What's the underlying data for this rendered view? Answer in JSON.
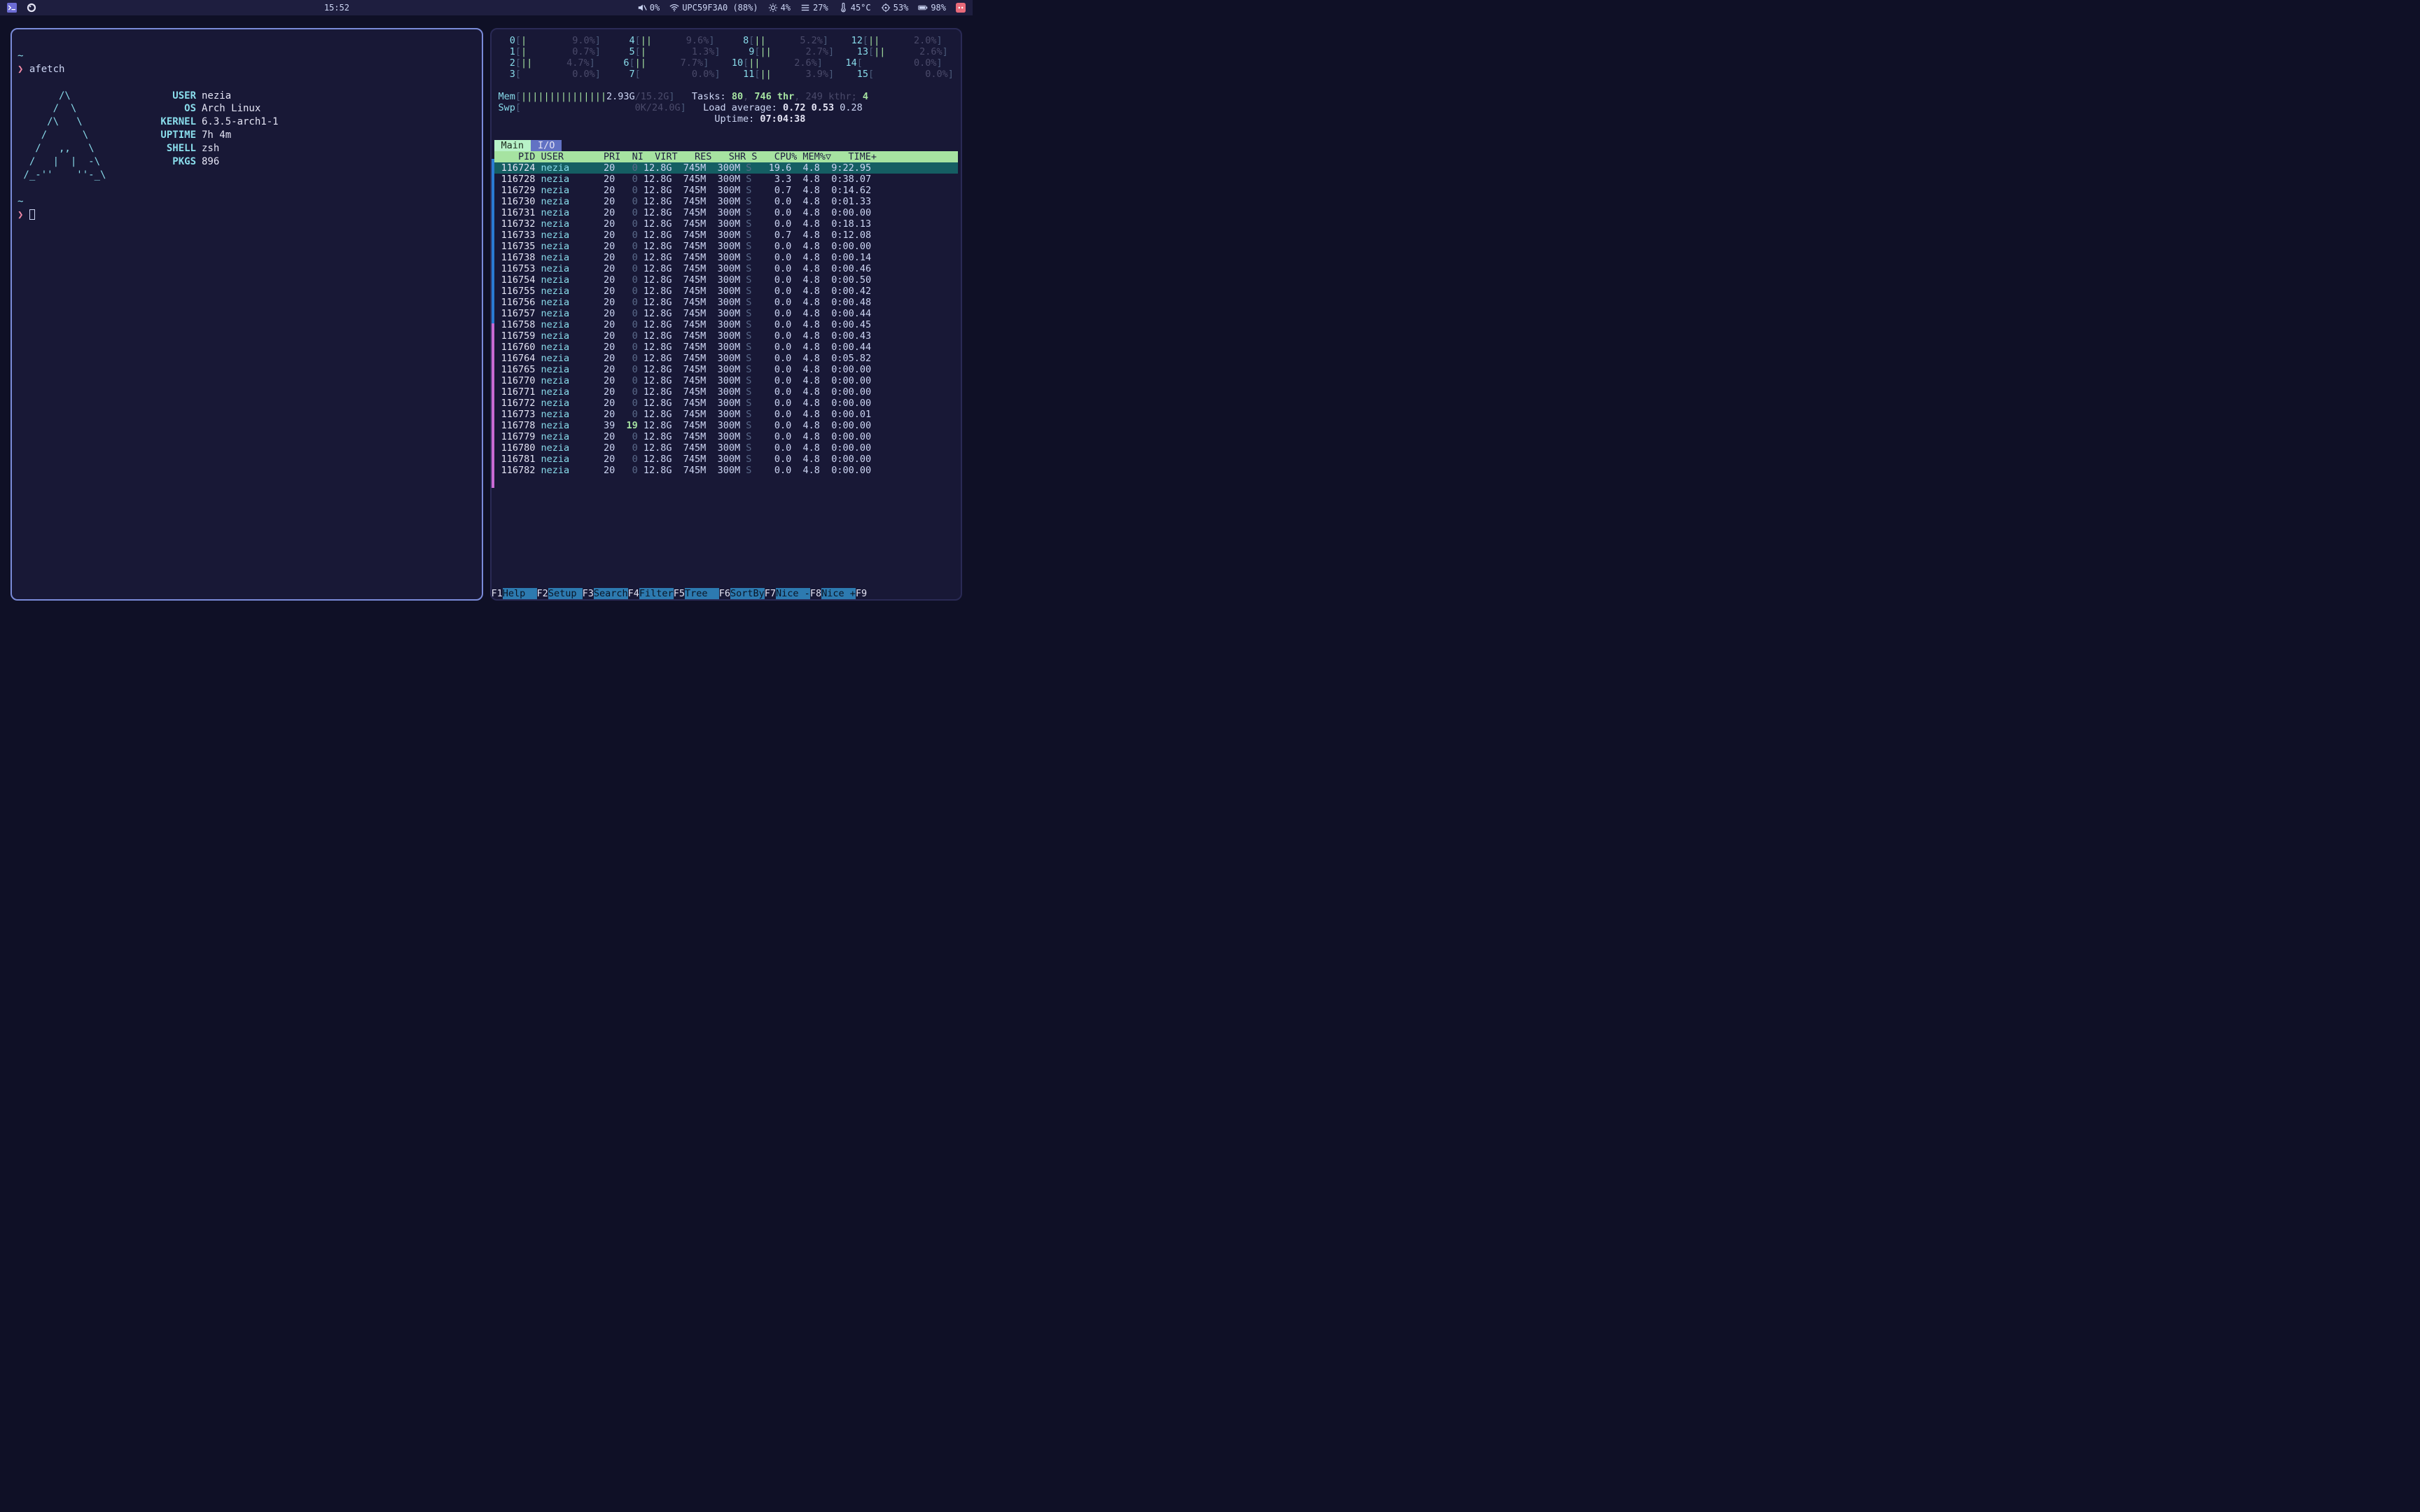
{
  "topbar": {
    "clock": "15:52",
    "volume_pct": "0%",
    "wifi_ssid": "UPC59F3A0 (88%)",
    "brightness_pct": "4%",
    "storage_pct": "27%",
    "temp": "45°C",
    "cpu_pct": "53%",
    "battery_pct": "98%"
  },
  "left_pane": {
    "prompt_symbol": "❯",
    "command": "afetch",
    "art": [
      "       /\\        ",
      "      /  \\       ",
      "     /\\   \\      ",
      "    /      \\     ",
      "   /   ,,   \\    ",
      "  /   |  |  -\\   ",
      " /_-''    ''-_\\  "
    ],
    "info": {
      "USER": "nezia",
      "OS": "Arch Linux",
      "KERNEL": "6.3.5-arch1-1",
      "UPTIME": "7h 4m",
      "SHELL": "zsh",
      "PKGS": "896"
    }
  },
  "htop": {
    "cpus": [
      {
        "n": "0",
        "bar": "|       ",
        "pct": "9.0%"
      },
      {
        "n": "1",
        "bar": "|       ",
        "pct": "0.7%"
      },
      {
        "n": "2",
        "bar": "||     ",
        "pct": "4.7%"
      },
      {
        "n": "3",
        "bar": "        ",
        "pct": "0.0%"
      },
      {
        "n": "4",
        "bar": "||     ",
        "pct": "9.6%"
      },
      {
        "n": "5",
        "bar": "|       ",
        "pct": "1.3%"
      },
      {
        "n": "6",
        "bar": "||     ",
        "pct": "7.7%"
      },
      {
        "n": "7",
        "bar": "        ",
        "pct": "0.0%"
      },
      {
        "n": "8",
        "bar": "||     ",
        "pct": "5.2%"
      },
      {
        "n": "9",
        "bar": "||     ",
        "pct": "2.7%"
      },
      {
        "n": "10",
        "bar": "||     ",
        "pct": "2.6%"
      },
      {
        "n": "11",
        "bar": "||     ",
        "pct": "3.9%"
      },
      {
        "n": "12",
        "bar": "||     ",
        "pct": "2.0%"
      },
      {
        "n": "13",
        "bar": "||     ",
        "pct": "2.6%"
      },
      {
        "n": "14",
        "bar": "        ",
        "pct": "0.0%"
      },
      {
        "n": "15",
        "bar": "        ",
        "pct": "0.0%"
      }
    ],
    "mem_label": "Mem",
    "mem_bar": "|||||||||||||||",
    "mem_used": "2.93G",
    "mem_total": "15.2G",
    "swp_label": "Swp",
    "swp_used": "0K",
    "swp_total": "24.0G",
    "tasks_label": "Tasks:",
    "tasks_procs": "80",
    "tasks_thr": "746",
    "tasks_thr_suffix": "thr",
    "tasks_kthr": "249",
    "tasks_kthr_suffix": "kthr",
    "tasks_running": "4",
    "load_label": "Load average:",
    "load": [
      "0.72",
      "0.53",
      "0.28"
    ],
    "uptime_label": "Uptime:",
    "uptime": "07:04:38",
    "tab_main": "Main",
    "tab_io": "I/O",
    "header": "    PID USER       PRI  NI  VIRT   RES   SHR S   CPU% MEM%▽   TIME+",
    "procs": [
      {
        "pid": "116724",
        "user": "nezia",
        "pri": "20",
        "ni": "0",
        "virt": "12.8G",
        "res": "745M",
        "shr": "300M",
        "s": "S",
        "cpu": "19.6",
        "mem": "4.8",
        "time": "9:22.95",
        "sel": true
      },
      {
        "pid": "116728",
        "user": "nezia",
        "pri": "20",
        "ni": "0",
        "virt": "12.8G",
        "res": "745M",
        "shr": "300M",
        "s": "S",
        "cpu": "3.3",
        "mem": "4.8",
        "time": "0:38.07"
      },
      {
        "pid": "116729",
        "user": "nezia",
        "pri": "20",
        "ni": "0",
        "virt": "12.8G",
        "res": "745M",
        "shr": "300M",
        "s": "S",
        "cpu": "0.7",
        "mem": "4.8",
        "time": "0:14.62"
      },
      {
        "pid": "116730",
        "user": "nezia",
        "pri": "20",
        "ni": "0",
        "virt": "12.8G",
        "res": "745M",
        "shr": "300M",
        "s": "S",
        "cpu": "0.0",
        "mem": "4.8",
        "time": "0:01.33"
      },
      {
        "pid": "116731",
        "user": "nezia",
        "pri": "20",
        "ni": "0",
        "virt": "12.8G",
        "res": "745M",
        "shr": "300M",
        "s": "S",
        "cpu": "0.0",
        "mem": "4.8",
        "time": "0:00.00"
      },
      {
        "pid": "116732",
        "user": "nezia",
        "pri": "20",
        "ni": "0",
        "virt": "12.8G",
        "res": "745M",
        "shr": "300M",
        "s": "S",
        "cpu": "0.0",
        "mem": "4.8",
        "time": "0:18.13"
      },
      {
        "pid": "116733",
        "user": "nezia",
        "pri": "20",
        "ni": "0",
        "virt": "12.8G",
        "res": "745M",
        "shr": "300M",
        "s": "S",
        "cpu": "0.7",
        "mem": "4.8",
        "time": "0:12.08"
      },
      {
        "pid": "116735",
        "user": "nezia",
        "pri": "20",
        "ni": "0",
        "virt": "12.8G",
        "res": "745M",
        "shr": "300M",
        "s": "S",
        "cpu": "0.0",
        "mem": "4.8",
        "time": "0:00.00"
      },
      {
        "pid": "116738",
        "user": "nezia",
        "pri": "20",
        "ni": "0",
        "virt": "12.8G",
        "res": "745M",
        "shr": "300M",
        "s": "S",
        "cpu": "0.0",
        "mem": "4.8",
        "time": "0:00.14"
      },
      {
        "pid": "116753",
        "user": "nezia",
        "pri": "20",
        "ni": "0",
        "virt": "12.8G",
        "res": "745M",
        "shr": "300M",
        "s": "S",
        "cpu": "0.0",
        "mem": "4.8",
        "time": "0:00.46"
      },
      {
        "pid": "116754",
        "user": "nezia",
        "pri": "20",
        "ni": "0",
        "virt": "12.8G",
        "res": "745M",
        "shr": "300M",
        "s": "S",
        "cpu": "0.0",
        "mem": "4.8",
        "time": "0:00.50"
      },
      {
        "pid": "116755",
        "user": "nezia",
        "pri": "20",
        "ni": "0",
        "virt": "12.8G",
        "res": "745M",
        "shr": "300M",
        "s": "S",
        "cpu": "0.0",
        "mem": "4.8",
        "time": "0:00.42"
      },
      {
        "pid": "116756",
        "user": "nezia",
        "pri": "20",
        "ni": "0",
        "virt": "12.8G",
        "res": "745M",
        "shr": "300M",
        "s": "S",
        "cpu": "0.0",
        "mem": "4.8",
        "time": "0:00.48"
      },
      {
        "pid": "116757",
        "user": "nezia",
        "pri": "20",
        "ni": "0",
        "virt": "12.8G",
        "res": "745M",
        "shr": "300M",
        "s": "S",
        "cpu": "0.0",
        "mem": "4.8",
        "time": "0:00.44"
      },
      {
        "pid": "116758",
        "user": "nezia",
        "pri": "20",
        "ni": "0",
        "virt": "12.8G",
        "res": "745M",
        "shr": "300M",
        "s": "S",
        "cpu": "0.0",
        "mem": "4.8",
        "time": "0:00.45"
      },
      {
        "pid": "116759",
        "user": "nezia",
        "pri": "20",
        "ni": "0",
        "virt": "12.8G",
        "res": "745M",
        "shr": "300M",
        "s": "S",
        "cpu": "0.0",
        "mem": "4.8",
        "time": "0:00.43"
      },
      {
        "pid": "116760",
        "user": "nezia",
        "pri": "20",
        "ni": "0",
        "virt": "12.8G",
        "res": "745M",
        "shr": "300M",
        "s": "S",
        "cpu": "0.0",
        "mem": "4.8",
        "time": "0:00.44"
      },
      {
        "pid": "116764",
        "user": "nezia",
        "pri": "20",
        "ni": "0",
        "virt": "12.8G",
        "res": "745M",
        "shr": "300M",
        "s": "S",
        "cpu": "0.0",
        "mem": "4.8",
        "time": "0:05.82"
      },
      {
        "pid": "116765",
        "user": "nezia",
        "pri": "20",
        "ni": "0",
        "virt": "12.8G",
        "res": "745M",
        "shr": "300M",
        "s": "S",
        "cpu": "0.0",
        "mem": "4.8",
        "time": "0:00.00"
      },
      {
        "pid": "116770",
        "user": "nezia",
        "pri": "20",
        "ni": "0",
        "virt": "12.8G",
        "res": "745M",
        "shr": "300M",
        "s": "S",
        "cpu": "0.0",
        "mem": "4.8",
        "time": "0:00.00"
      },
      {
        "pid": "116771",
        "user": "nezia",
        "pri": "20",
        "ni": "0",
        "virt": "12.8G",
        "res": "745M",
        "shr": "300M",
        "s": "S",
        "cpu": "0.0",
        "mem": "4.8",
        "time": "0:00.00"
      },
      {
        "pid": "116772",
        "user": "nezia",
        "pri": "20",
        "ni": "0",
        "virt": "12.8G",
        "res": "745M",
        "shr": "300M",
        "s": "S",
        "cpu": "0.0",
        "mem": "4.8",
        "time": "0:00.00"
      },
      {
        "pid": "116773",
        "user": "nezia",
        "pri": "20",
        "ni": "0",
        "virt": "12.8G",
        "res": "745M",
        "shr": "300M",
        "s": "S",
        "cpu": "0.0",
        "mem": "4.8",
        "time": "0:00.01"
      },
      {
        "pid": "116778",
        "user": "nezia",
        "pri": "39",
        "ni": "19",
        "virt": "12.8G",
        "res": "745M",
        "shr": "300M",
        "s": "S",
        "cpu": "0.0",
        "mem": "4.8",
        "time": "0:00.00"
      },
      {
        "pid": "116779",
        "user": "nezia",
        "pri": "20",
        "ni": "0",
        "virt": "12.8G",
        "res": "745M",
        "shr": "300M",
        "s": "S",
        "cpu": "0.0",
        "mem": "4.8",
        "time": "0:00.00"
      },
      {
        "pid": "116780",
        "user": "nezia",
        "pri": "20",
        "ni": "0",
        "virt": "12.8G",
        "res": "745M",
        "shr": "300M",
        "s": "S",
        "cpu": "0.0",
        "mem": "4.8",
        "time": "0:00.00"
      },
      {
        "pid": "116781",
        "user": "nezia",
        "pri": "20",
        "ni": "0",
        "virt": "12.8G",
        "res": "745M",
        "shr": "300M",
        "s": "S",
        "cpu": "0.0",
        "mem": "4.8",
        "time": "0:00.00"
      },
      {
        "pid": "116782",
        "user": "nezia",
        "pri": "20",
        "ni": "0",
        "virt": "12.8G",
        "res": "745M",
        "shr": "300M",
        "s": "S",
        "cpu": "0.0",
        "mem": "4.8",
        "time": "0:00.00"
      }
    ],
    "fn": [
      {
        "k": "F1",
        "a": "Help  "
      },
      {
        "k": "F2",
        "a": "Setup "
      },
      {
        "k": "F3",
        "a": "Search"
      },
      {
        "k": "F4",
        "a": "Filter"
      },
      {
        "k": "F5",
        "a": "Tree  "
      },
      {
        "k": "F6",
        "a": "SortBy"
      },
      {
        "k": "F7",
        "a": "Nice -"
      },
      {
        "k": "F8",
        "a": "Nice +"
      },
      {
        "k": "F9",
        "a": ""
      }
    ]
  }
}
